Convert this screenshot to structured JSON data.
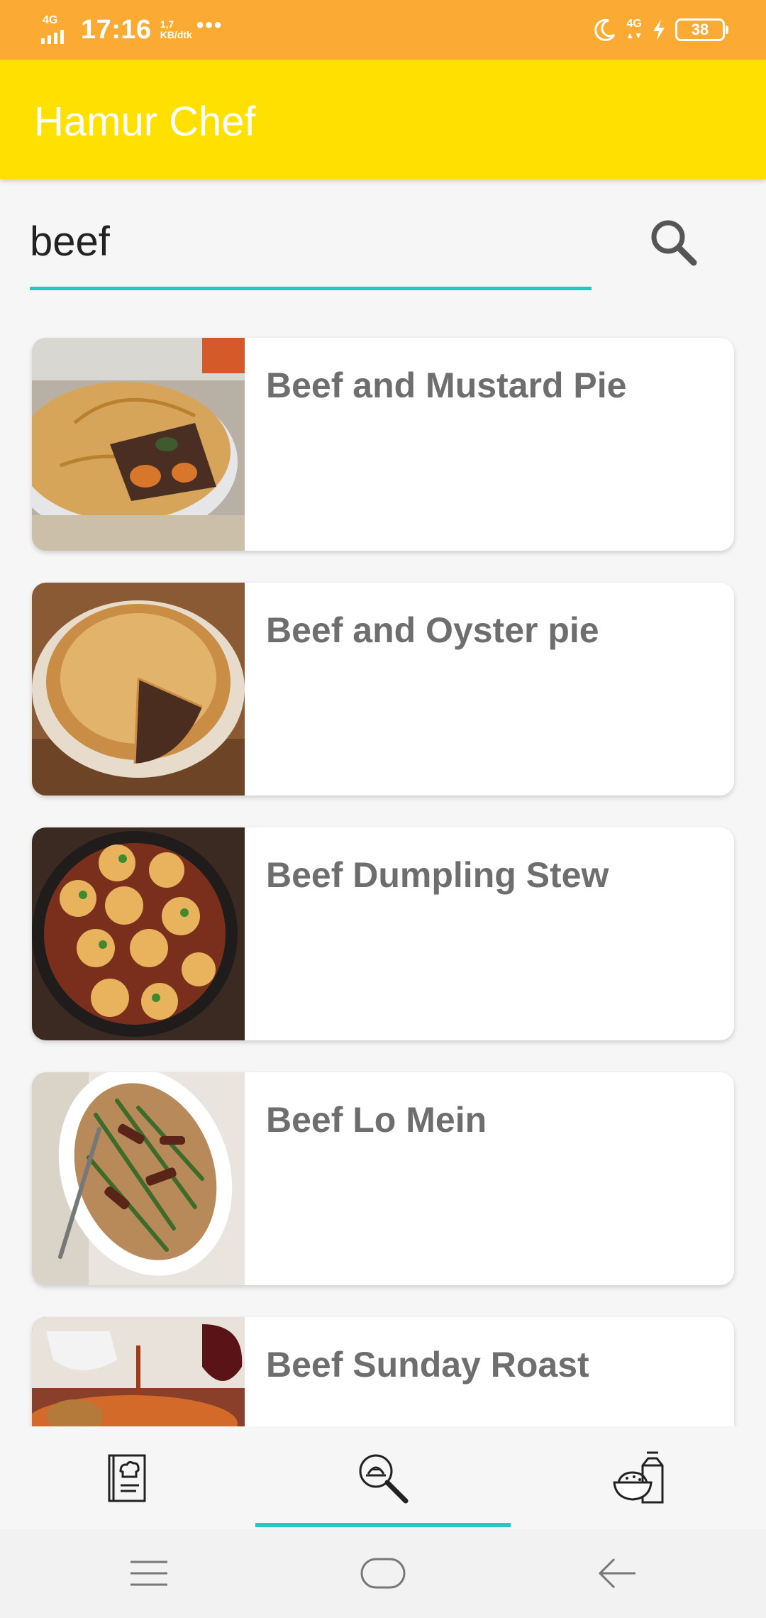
{
  "status_bar": {
    "network": "4G",
    "time": "17:16",
    "speed_value": "1,7",
    "speed_unit": "KB/dtk",
    "more": "•••",
    "network_right": "4G",
    "battery": "38"
  },
  "app_bar": {
    "title": "Hamur Chef"
  },
  "search": {
    "value": "beef",
    "icon": "search-icon"
  },
  "results": [
    {
      "title": "Beef and Mustard Pie",
      "image": "beef-and-mustard-pie-photo"
    },
    {
      "title": "Beef and Oyster pie",
      "image": "beef-and-oyster-pie-photo"
    },
    {
      "title": "Beef Dumpling Stew",
      "image": "beef-dumpling-stew-photo"
    },
    {
      "title": "Beef Lo Mein",
      "image": "beef-lo-mein-photo"
    },
    {
      "title": "Beef Sunday Roast",
      "image": "beef-sunday-roast-photo"
    }
  ],
  "bottom_nav": {
    "items": [
      {
        "icon": "recipe-book-icon",
        "selected": false
      },
      {
        "icon": "search-dish-icon",
        "selected": true
      },
      {
        "icon": "ingredients-icon",
        "selected": false
      }
    ],
    "indicator_color": "#22c9be"
  },
  "colors": {
    "status_bar": "#fbab33",
    "app_bar": "#ffe000",
    "accent": "#22c9be",
    "card_title": "#6e6e6e"
  }
}
